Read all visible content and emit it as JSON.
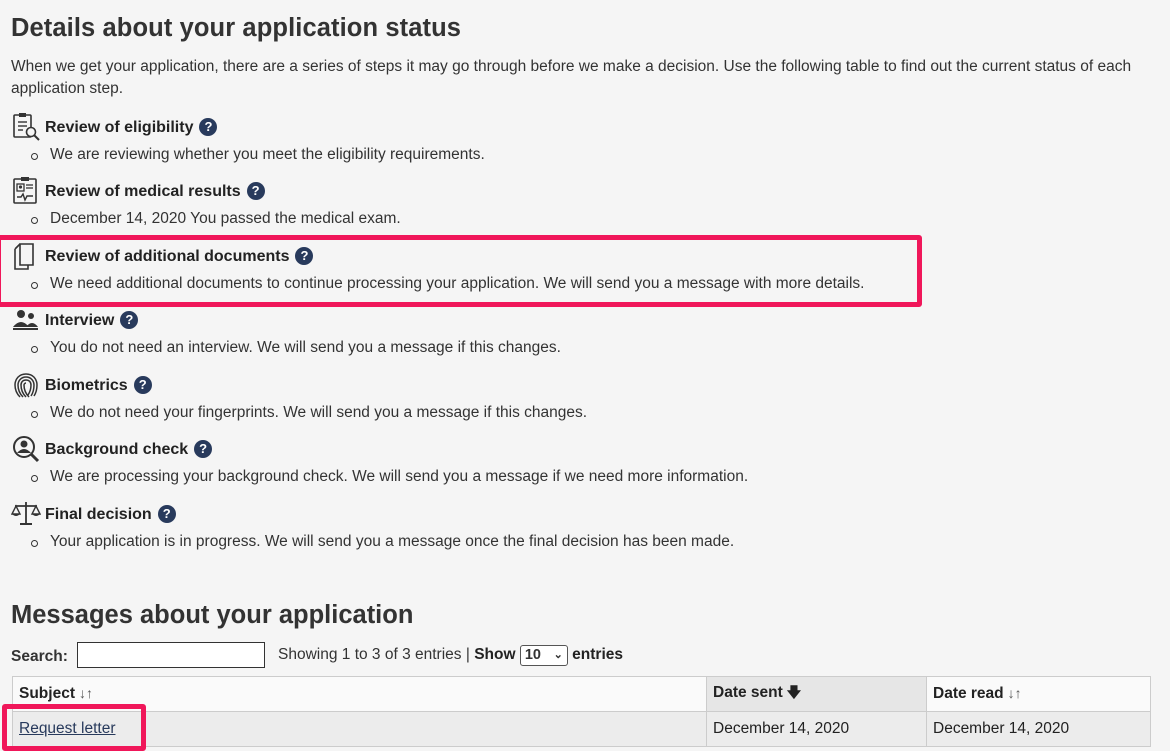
{
  "status": {
    "heading": "Details about your application status",
    "intro": "When we get your application, there are a series of steps it may go through before we make a decision. Use the following table to find out the current status of each application step.",
    "help_glyph": "?",
    "steps": [
      {
        "title": "Review of eligibility",
        "icon": "clipboard-search-icon",
        "detail": "We are reviewing whether you meet the eligibility requirements."
      },
      {
        "title": "Review of medical results",
        "icon": "medical-report-icon",
        "detail": "December 14, 2020 You passed the medical exam."
      },
      {
        "title": "Review of additional documents",
        "icon": "documents-icon",
        "detail": "We need additional documents to continue processing your application. We will send you a message with more details."
      },
      {
        "title": "Interview",
        "icon": "people-icon",
        "detail": "You do not need an interview. We will send you a message if this changes."
      },
      {
        "title": "Biometrics",
        "icon": "fingerprint-icon",
        "detail": "We do not need your fingerprints. We will send you a message if this changes."
      },
      {
        "title": "Background check",
        "icon": "person-search-icon",
        "detail": "We are processing your background check. We will send you a message if we need more information."
      },
      {
        "title": "Final decision",
        "icon": "scales-icon",
        "detail": "Your application is in progress. We will send you a message once the final decision has been made."
      }
    ]
  },
  "messages": {
    "heading": "Messages about your application",
    "search_label": "Search:",
    "search_value": "",
    "showing_text": "Showing 1 to 3 of 3 entries",
    "separator": "|",
    "show_label": "Show",
    "length_selected": "10",
    "entries_label": "entries",
    "columns": [
      "Subject",
      "Date sent",
      "Date read"
    ],
    "rows": [
      {
        "subject": "Request letter",
        "date_sent": "December 14, 2020",
        "date_read": "December 14, 2020"
      }
    ]
  },
  "colors": {
    "highlight": "#f0175a",
    "help_icon": "#283a5c",
    "link": "#283a5c"
  }
}
